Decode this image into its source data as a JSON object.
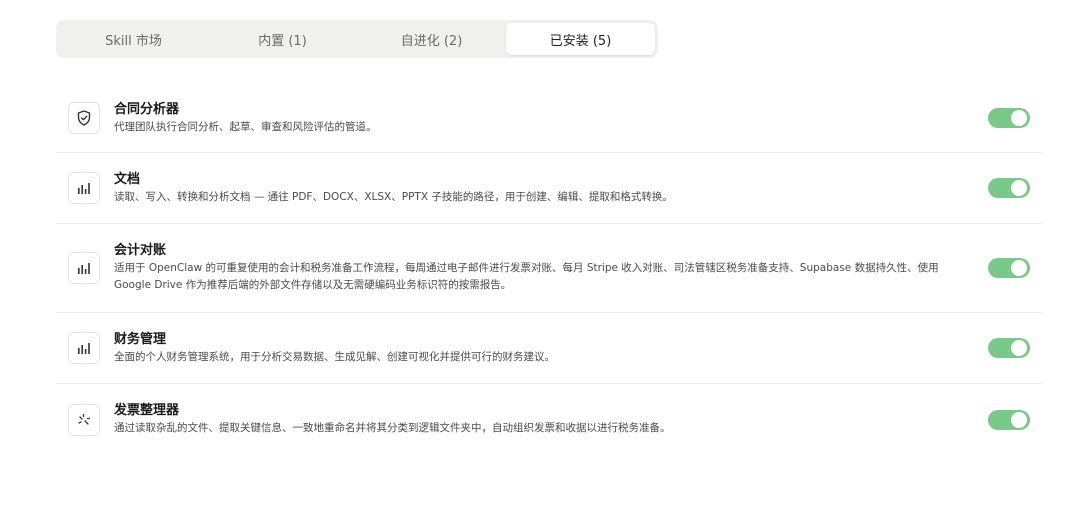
{
  "tabs": [
    {
      "label": "Skill 市场",
      "active": false
    },
    {
      "label": "内置 (1)",
      "active": false
    },
    {
      "label": "自进化 (2)",
      "active": false
    },
    {
      "label": "已安装 (5)",
      "active": true
    }
  ],
  "skills": [
    {
      "icon": "shield-check-icon",
      "title": "合同分析器",
      "description": "代理团队执行合同分析、起草、审查和风险评估的管道。",
      "enabled": true
    },
    {
      "icon": "bar-chart-icon",
      "title": "文档",
      "description": "读取、写入、转换和分析文档 — 通往 PDF、DOCX、XLSX、PPTX 子技能的路径，用于创建、编辑、提取和格式转换。",
      "enabled": true
    },
    {
      "icon": "bar-chart-icon",
      "title": "会计对账",
      "description": "适用于 OpenClaw 的可重复使用的会计和税务准备工作流程，每周通过电子邮件进行发票对账、每月 Stripe 收入对账、司法管辖区税务准备支持、Supabase 数据持久性、使用 Google Drive 作为推荐后端的外部文件存储以及无需硬编码业务标识符的按需报告。",
      "enabled": true
    },
    {
      "icon": "bar-chart-icon",
      "title": "财务管理",
      "description": "全面的个人财务管理系统，用于分析交易数据、生成见解、创建可视化并提供可行的财务建议。",
      "enabled": true
    },
    {
      "icon": "sparkle-icon",
      "title": "发票整理器",
      "description": "通过读取杂乱的文件、提取关键信息、一致地重命名并将其分类到逻辑文件夹中，自动组织发票和收据以进行税务准备。",
      "enabled": true
    }
  ],
  "colors": {
    "toggle_on": "#79c98a",
    "tab_bg": "#f0f0ef"
  }
}
